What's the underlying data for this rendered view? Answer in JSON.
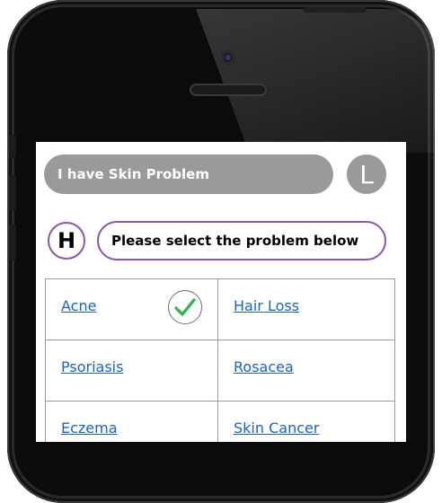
{
  "chat": {
    "user_message": "I have Skin Problem",
    "user_avatar": "L",
    "bot_avatar": "H",
    "bot_message": "Please select the problem below"
  },
  "options": [
    {
      "label": "Acne",
      "selected": true,
      "icon": "check-circle-icon"
    },
    {
      "label": "Hair Loss",
      "selected": false
    },
    {
      "label": "Psoriasis",
      "selected": false
    },
    {
      "label": "Rosacea",
      "selected": false
    },
    {
      "label": "Eczema",
      "selected": false
    },
    {
      "label": "Skin Cancer",
      "selected": false
    }
  ],
  "colors": {
    "user_bubble": "#9a9a9a",
    "bot_border": "#8a55b0",
    "link": "#1a63c8",
    "check": "#2db34a"
  }
}
